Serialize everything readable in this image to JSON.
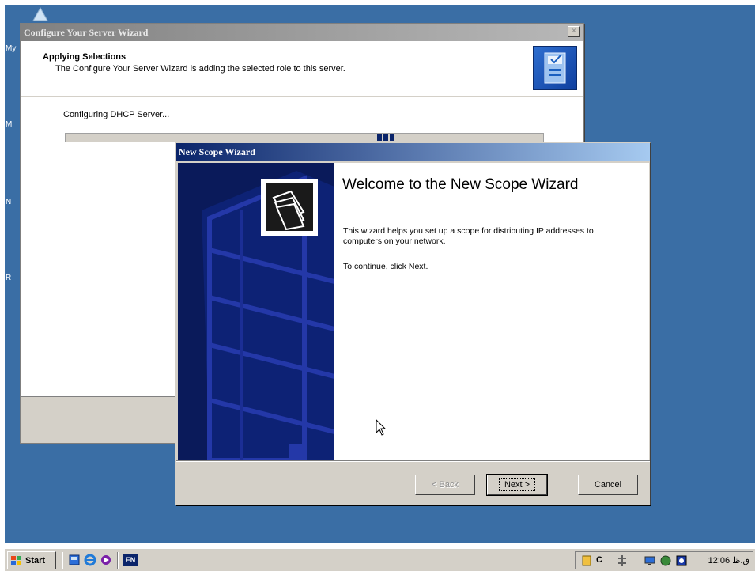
{
  "desktop": {
    "icon_labels": [
      "My",
      "M",
      "N",
      "R"
    ]
  },
  "configure_wizard": {
    "title": "Configure Your Server Wizard",
    "close_glyph": "×",
    "heading": "Applying Selections",
    "subheading": "The Configure Your Server Wizard is adding the selected role to this server.",
    "status_text": "Configuring DHCP Server..."
  },
  "scope_wizard": {
    "title": "New Scope Wizard",
    "welcome_heading": "Welcome to the New Scope Wizard",
    "description": "This wizard helps you set up a scope for distributing IP addresses to computers on your network.",
    "continue_text": "To continue, click Next.",
    "buttons": {
      "back": "< Back",
      "next": "Next >",
      "cancel": "Cancel"
    }
  },
  "taskbar": {
    "start_label": "Start",
    "language": "EN",
    "tray_text": "C",
    "clock": "12:06 ق.ظ"
  },
  "colors": {
    "desktop": "#3a6ea5",
    "active_title": "#0a246a",
    "inactive_title": "#808080",
    "window_face": "#d4d0c8"
  }
}
